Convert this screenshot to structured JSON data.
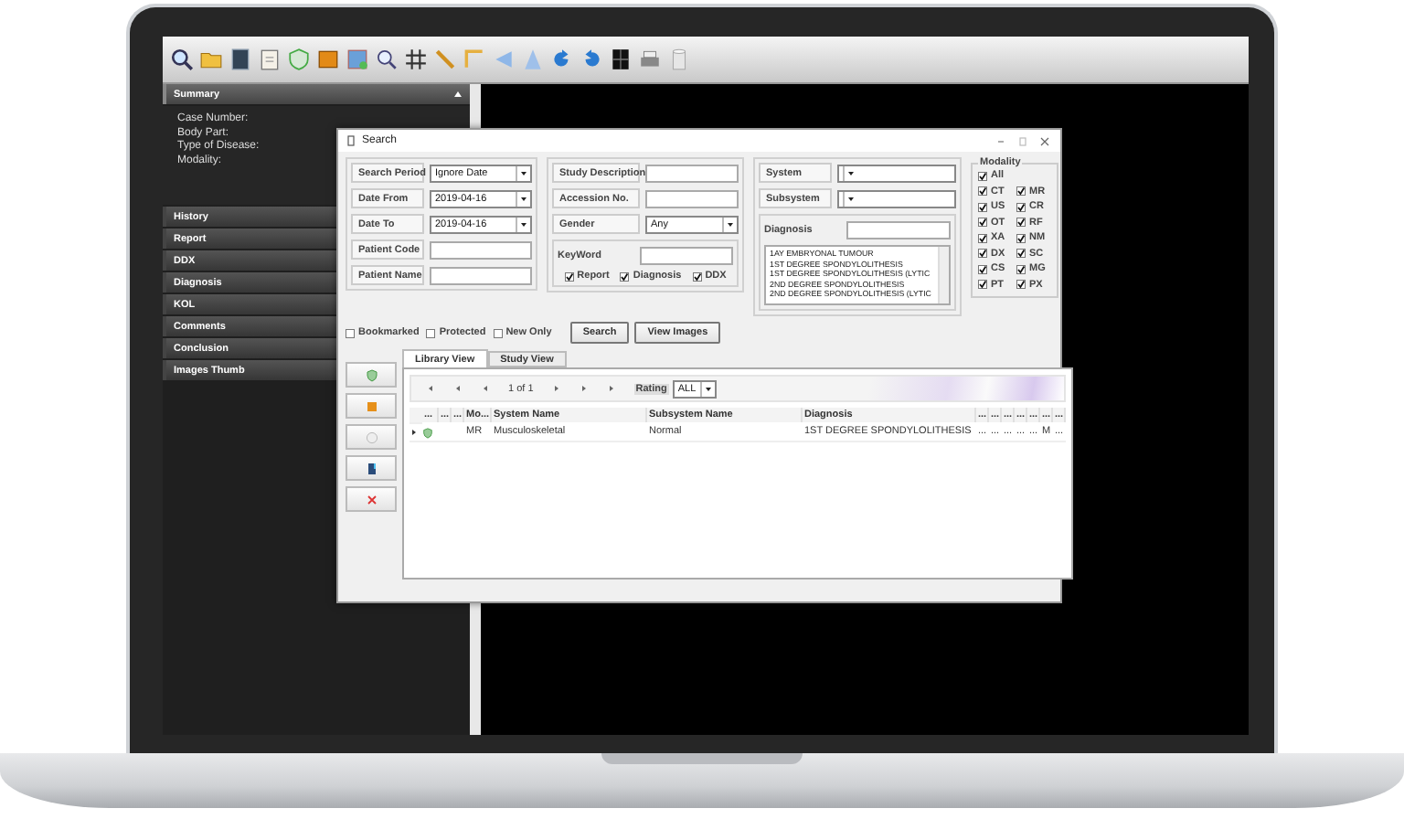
{
  "sidebar": {
    "sections": [
      {
        "title": "Summary",
        "expanded": true,
        "lines": [
          "Case Number:",
          "Body Part:",
          "Type of Disease:",
          "Modality:"
        ]
      },
      {
        "title": "History",
        "expanded": false
      },
      {
        "title": "Report",
        "expanded": false
      },
      {
        "title": "DDX",
        "expanded": false
      },
      {
        "title": "Diagnosis",
        "expanded": false
      },
      {
        "title": "KOL",
        "expanded": false
      },
      {
        "title": "Comments",
        "expanded": false
      },
      {
        "title": "Conclusion",
        "expanded": false
      },
      {
        "title": "Images Thumb",
        "expanded": false
      }
    ]
  },
  "dialog": {
    "title": "Search",
    "left_fields": [
      {
        "label": "Search Period",
        "kind": "combo",
        "value": "Ignore Date"
      },
      {
        "label": "Date From",
        "kind": "combo",
        "value": "2019-04-16"
      },
      {
        "label": "Date To",
        "kind": "combo",
        "value": "2019-04-16"
      },
      {
        "label": "Patient Code",
        "kind": "text"
      },
      {
        "label": "Patient Name",
        "kind": "text"
      }
    ],
    "middle_fields": [
      {
        "label": "Study Description",
        "kind": "text"
      },
      {
        "label": "Accession No.",
        "kind": "text"
      },
      {
        "label": "Gender",
        "kind": "combo",
        "value": "Any"
      }
    ],
    "keyword": {
      "label": "KeyWord",
      "options": [
        {
          "label": "Report",
          "checked": true
        },
        {
          "label": "Diagnosis",
          "checked": true
        },
        {
          "label": "DDX",
          "checked": true
        }
      ]
    },
    "right_fields": [
      {
        "label": "System",
        "kind": "combo"
      },
      {
        "label": "Subsystem",
        "kind": "combo"
      }
    ],
    "diagnosis": {
      "label": "Diagnosis",
      "items": [
        "1AY EMBRYONAL TUMOUR",
        "1ST DEGREE SPONDYLOLITHESIS",
        "1ST DEGREE SPONDYLOLITHESIS (LYTIC",
        "2ND DEGREE SPONDYLOLITHESIS",
        "2ND DEGREE SPONDYLOLITHESIS (LYTIC"
      ]
    },
    "modality": {
      "title": "Modality",
      "all": {
        "label": "All",
        "checked": true
      },
      "items": [
        {
          "label": "CT",
          "checked": true
        },
        {
          "label": "MR",
          "checked": true
        },
        {
          "label": "US",
          "checked": true
        },
        {
          "label": "CR",
          "checked": true
        },
        {
          "label": "OT",
          "checked": true
        },
        {
          "label": "RF",
          "checked": true
        },
        {
          "label": "XA",
          "checked": true
        },
        {
          "label": "NM",
          "checked": true
        },
        {
          "label": "DX",
          "checked": true
        },
        {
          "label": "SC",
          "checked": true
        },
        {
          "label": "CS",
          "checked": true
        },
        {
          "label": "MG",
          "checked": true
        },
        {
          "label": "PT",
          "checked": true
        },
        {
          "label": "PX",
          "checked": true
        }
      ]
    },
    "flags": [
      {
        "label": "Bookmarked",
        "checked": false
      },
      {
        "label": "Protected",
        "checked": false
      },
      {
        "label": "New Only",
        "checked": false
      }
    ],
    "buttons": [
      "Search",
      "View Images"
    ],
    "tabs": [
      {
        "label": "Library View",
        "selected": true
      },
      {
        "label": "Study View",
        "selected": false
      }
    ],
    "pager": {
      "text": "1 of 1",
      "rating_label": "Rating",
      "rating_value": "ALL"
    },
    "table": {
      "lead_columns": [
        "...",
        "...",
        "..."
      ],
      "columns": [
        "Mo...",
        "System Name",
        "Subsystem Name",
        "Diagnosis",
        "...",
        "...",
        "...",
        "...",
        "...",
        "...",
        "..."
      ],
      "rows": [
        {
          "cells": [
            "MR",
            "Musculoskeletal",
            "Normal",
            "1ST DEGREE SPONDYLOLITHESIS",
            "...",
            "...",
            "...",
            "...",
            "...",
            "M",
            "..."
          ]
        }
      ]
    }
  }
}
